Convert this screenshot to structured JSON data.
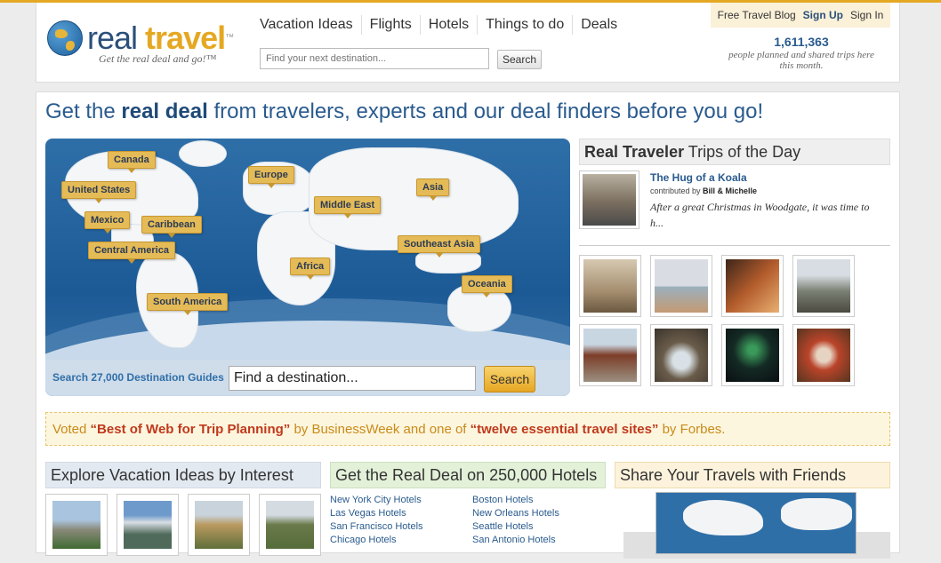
{
  "header": {
    "logo_real": "real",
    "logo_travel": "travel",
    "logo_tm": "™",
    "tagline": "Get the real deal and go!™",
    "nav": [
      "Vacation Ideas",
      "Flights",
      "Hotels",
      "Things to do",
      "Deals"
    ],
    "search_placeholder": "Find your next destination...",
    "search_button": "Search",
    "account": {
      "blog": "Free Travel Blog",
      "signup": "Sign Up",
      "signin": "Sign In"
    },
    "stats_number": "1,611,363",
    "stats_caption": "people planned and shared trips here this month."
  },
  "headline": {
    "pre": "Get the ",
    "bold": "real deal",
    "post": " from travelers, experts and our deal finders before you go!"
  },
  "map": {
    "regions": [
      "Canada",
      "United States",
      "Mexico",
      "Caribbean",
      "Central America",
      "South America",
      "Europe",
      "Middle East",
      "Africa",
      "Asia",
      "Southeast Asia",
      "Oceania"
    ],
    "search_label": "Search 27,000 Destination Guides",
    "search_value": "Find a destination...",
    "search_button": "Search"
  },
  "trips": {
    "heading_bold": "Real Traveler",
    "heading_rest": " Trips of the Day",
    "featured_title": "The Hug of a Koala",
    "contributed_prefix": "contributed by ",
    "contributor": "Bill & Michelle",
    "excerpt": "After a great Christmas in Woodgate, it was time to h..."
  },
  "voted": {
    "t1": "Voted ",
    "q1": "“Best of Web for Trip Planning”",
    "t2": " by BusinessWeek and one of ",
    "q2": "“twelve essential travel sites”",
    "t3": " by Forbes."
  },
  "sections": {
    "interests": "Explore Vacation Ideas by Interest",
    "hotels": "Get the Real Deal on 250,000 Hotels",
    "share": "Share Your Travels with Friends"
  },
  "hotels": [
    "New York City Hotels",
    "Boston Hotels",
    "Las Vegas Hotels",
    "New Orleans Hotels",
    "San Francisco Hotels",
    "Seattle Hotels",
    "Chicago Hotels",
    "San Antonio Hotels"
  ],
  "colors": {
    "accent": "#e5a823",
    "brand_blue": "#2a5b8e",
    "highlight_red": "#c0391b"
  }
}
